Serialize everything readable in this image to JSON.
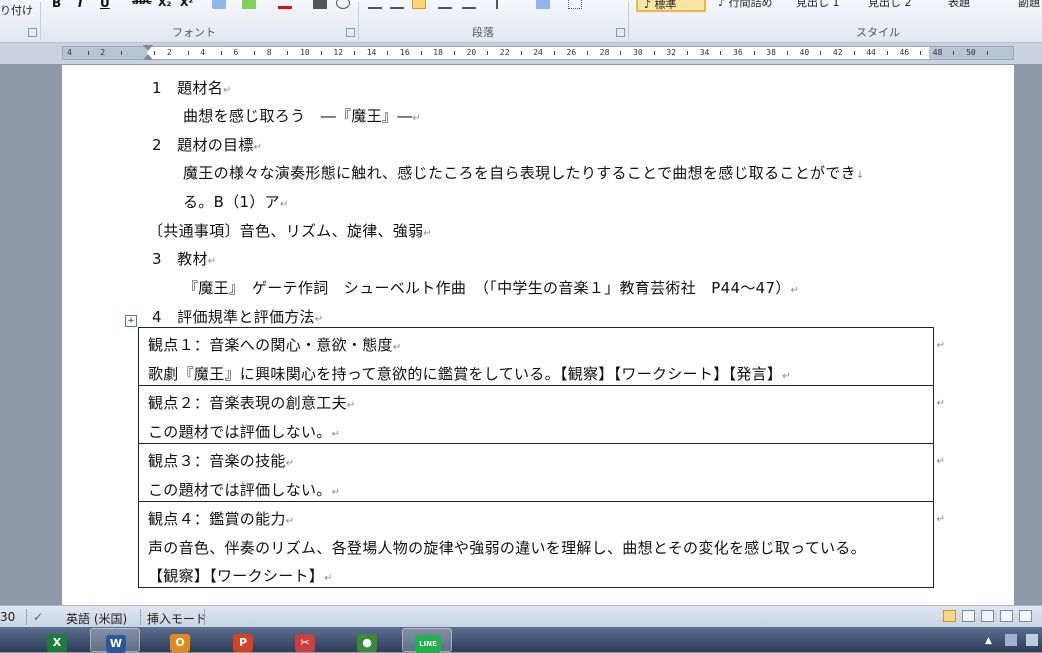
{
  "ribbon": {
    "paste_label_fragment": "り付け",
    "font_group_label": "フォント",
    "paragraph_group_label": "段落",
    "styles_group_label": "スタイル",
    "bold": "B",
    "italic": "I",
    "underline": "U",
    "strike": "abc",
    "subscript": "X₂",
    "superscript": "X²",
    "styles": [
      {
        "label": "♪ 標準",
        "selected": true
      },
      {
        "label": "♪ 行間詰め",
        "selected": false
      },
      {
        "label": "見出し 1",
        "selected": false
      },
      {
        "label": "見出し 2",
        "selected": false
      },
      {
        "label": "表題",
        "selected": false
      },
      {
        "label": "副題",
        "selected": false
      }
    ]
  },
  "ruler": {
    "labels": [
      "4",
      "2",
      "",
      "2",
      "4",
      "6",
      "8",
      "10",
      "12",
      "14",
      "16",
      "18",
      "20",
      "22",
      "24",
      "26",
      "28",
      "30",
      "32",
      "34",
      "36",
      "38",
      "40",
      "42",
      "44",
      "46",
      "48",
      "50"
    ]
  },
  "document": {
    "paragraphs": [
      {
        "text": "1　題材名"
      },
      {
        "text": "曲想を感じ取ろう　―『魔王』―"
      },
      {
        "text": "2　題材の目標"
      },
      {
        "text": "魔王の様々な演奏形態に触れ、感じたころを自ら表現したりすることで曲想を感じ取ることができ"
      },
      {
        "text": "る。B（1）ア"
      },
      {
        "text": "〔共通事項〕音色、リズム、旋律、強弱"
      },
      {
        "text": "3　教材"
      },
      {
        "text": "『魔王』　ゲーテ作詞　シューベルト作曲　（「中学生の音楽１」教育芸術社　P44～47）"
      },
      {
        "text": "4　評価規準と評価方法"
      }
    ],
    "table": [
      {
        "lines": [
          "観点１：音楽への関心・意欲・態度",
          "歌劇『魔王』に興味関心を持って意欲的に鑑賞をしている。【観察】【ワークシート】【発言】"
        ]
      },
      {
        "lines": [
          "観点２：音楽表現の創意工夫",
          "この題材では評価しない。"
        ]
      },
      {
        "lines": [
          "観点３：音楽の技能",
          "この題材では評価しない。"
        ]
      },
      {
        "lines": [
          "観点４：鑑賞の能力",
          "声の音色、伴奏のリズム、各登場人物の旋律や強弱の違いを理解し、曲想とその変化を感じ取っている。",
          "【観察】【ワークシート】"
        ]
      }
    ]
  },
  "statusbar": {
    "page_count_fragment": "30",
    "language": "英語 (米国)",
    "mode": "挿入モード"
  },
  "taskbar": {
    "apps": [
      {
        "name": "excel",
        "glyph": "X",
        "color": "#1e7b3c",
        "active": false
      },
      {
        "name": "word",
        "glyph": "W",
        "color": "#2b579a",
        "active": true
      },
      {
        "name": "outlook",
        "glyph": "O",
        "color": "#e08a1e",
        "active": false
      },
      {
        "name": "powerpoint",
        "glyph": "P",
        "color": "#d04423",
        "active": false
      },
      {
        "name": "snipping-tool",
        "glyph": "✂",
        "color": "#c94040",
        "active": false
      },
      {
        "name": "chrome",
        "glyph": "●",
        "color": "#3a8a3a",
        "active": false
      },
      {
        "name": "line",
        "glyph": "LINE",
        "color": "#21b24b",
        "active": true
      }
    ]
  }
}
